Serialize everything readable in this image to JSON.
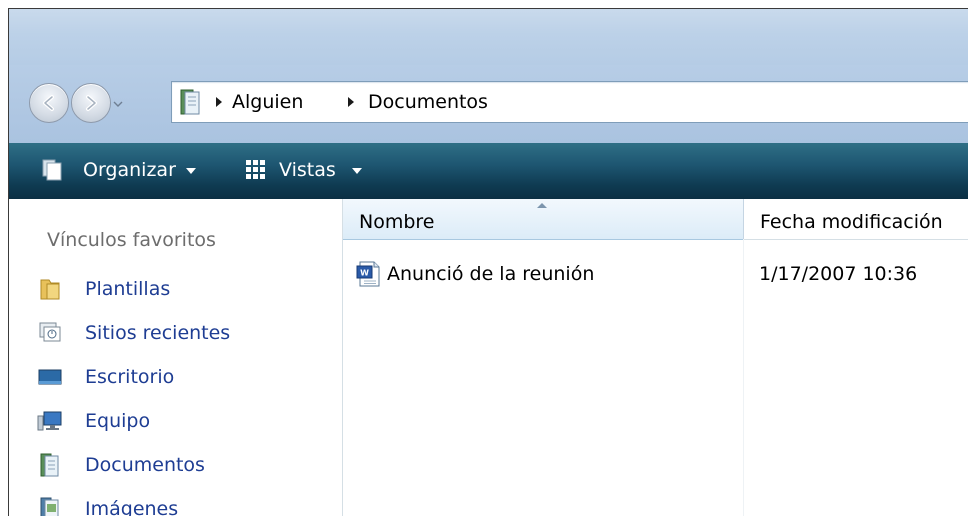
{
  "address": {
    "crumbs": [
      "Alguien",
      "Documentos"
    ]
  },
  "toolbar": {
    "organize_label": "Organizar",
    "views_label": "Vistas"
  },
  "nav": {
    "header": "Vínculos favoritos",
    "items": [
      {
        "label": "Plantillas",
        "icon": "folder-icon"
      },
      {
        "label": "Sitios recientes",
        "icon": "recent-places-icon"
      },
      {
        "label": "Escritorio",
        "icon": "desktop-icon"
      },
      {
        "label": "Equipo",
        "icon": "computer-icon"
      },
      {
        "label": "Documentos",
        "icon": "documents-icon"
      },
      {
        "label": "Imágenes",
        "icon": "pictures-icon"
      }
    ]
  },
  "list": {
    "columns": [
      "Nombre",
      "Fecha modificación"
    ],
    "files": [
      {
        "name": "Anunció de la reunión",
        "modified": "1/17/2007 10:36",
        "icon": "word-document-icon"
      }
    ]
  },
  "colors": {
    "toolbar": "#1d5570",
    "link": "#1e3d93",
    "header_selected": "#dcecf8"
  }
}
